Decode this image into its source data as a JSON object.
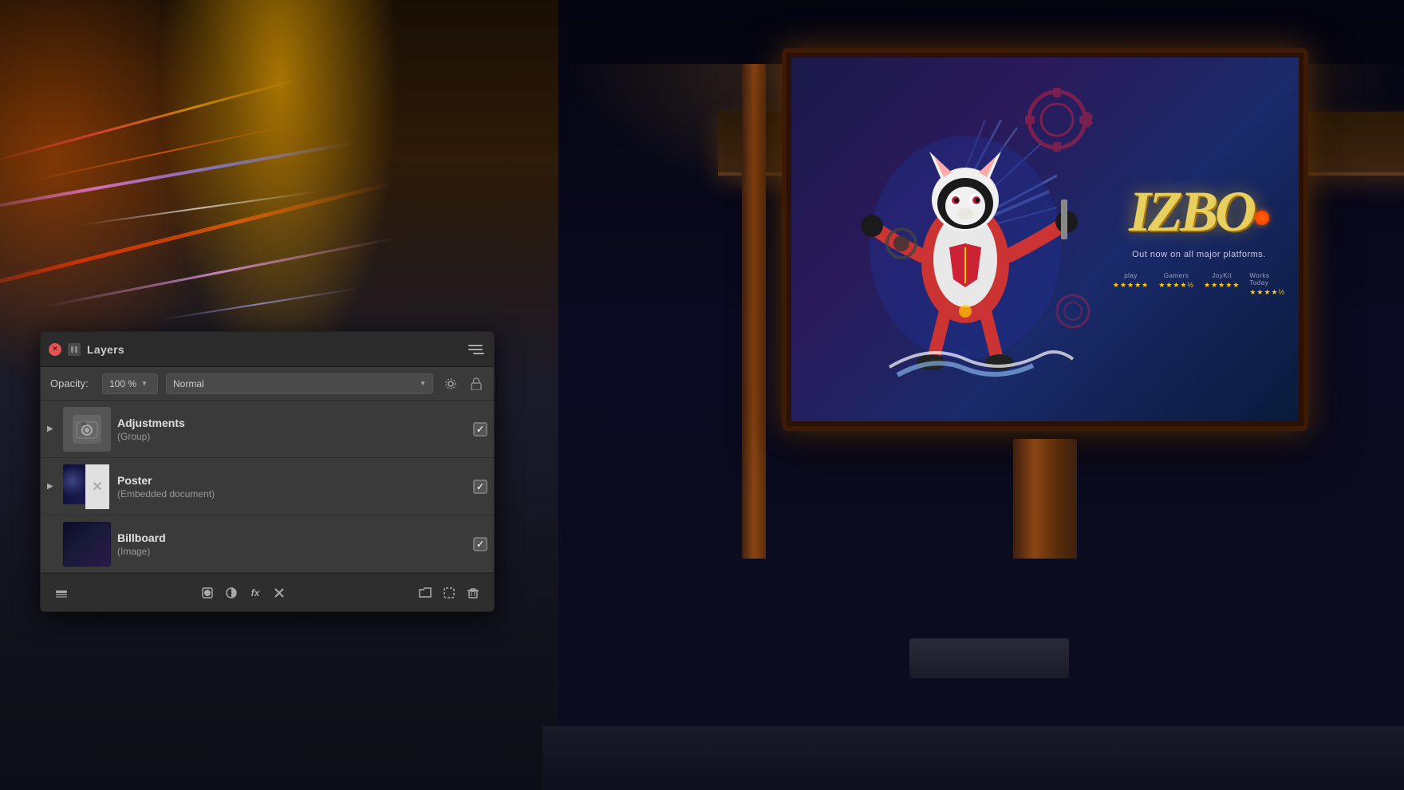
{
  "background": {
    "description": "Night city street with bus stop billboard"
  },
  "panel": {
    "title": "Layers",
    "close_label": "×",
    "opacity_label": "Opacity:",
    "opacity_value": "100 %",
    "blend_mode": "Normal",
    "layers": [
      {
        "id": "adjustments",
        "name": "Adjustments",
        "type": "(Group)",
        "has_expand": true,
        "checked": true,
        "thumb_type": "adjustments"
      },
      {
        "id": "poster",
        "name": "Poster",
        "type": "(Embedded document)",
        "has_expand": true,
        "checked": true,
        "thumb_type": "poster"
      },
      {
        "id": "billboard",
        "name": "Billboard",
        "type": "(Image)",
        "has_expand": false,
        "checked": true,
        "thumb_type": "billboard"
      }
    ],
    "toolbar_buttons": [
      {
        "id": "layers-icon",
        "icon": "⊞",
        "label": "layers"
      },
      {
        "id": "circle-icon",
        "icon": "◯",
        "label": "circle-shape"
      },
      {
        "id": "half-circle-icon",
        "icon": "◑",
        "label": "half-circle"
      },
      {
        "id": "fx-icon",
        "icon": "fx",
        "label": "effects"
      },
      {
        "id": "mask-icon",
        "icon": "✕",
        "label": "mask"
      },
      {
        "id": "folder-icon",
        "icon": "⊡",
        "label": "folder"
      },
      {
        "id": "selection-icon",
        "icon": "⊟",
        "label": "selection"
      },
      {
        "id": "delete-icon",
        "icon": "🗑",
        "label": "delete"
      }
    ]
  },
  "billboard": {
    "game_title": "IZBO",
    "tagline": "Out now on all major platforms.",
    "ratings": [
      {
        "platform": "play",
        "stars": "★★★★★"
      },
      {
        "platform": "Gamers",
        "stars": "★★★★½"
      },
      {
        "platform": "JoyKit",
        "stars": "★★★★★"
      },
      {
        "platform": "Works Today",
        "stars": "★★★★½"
      }
    ]
  }
}
